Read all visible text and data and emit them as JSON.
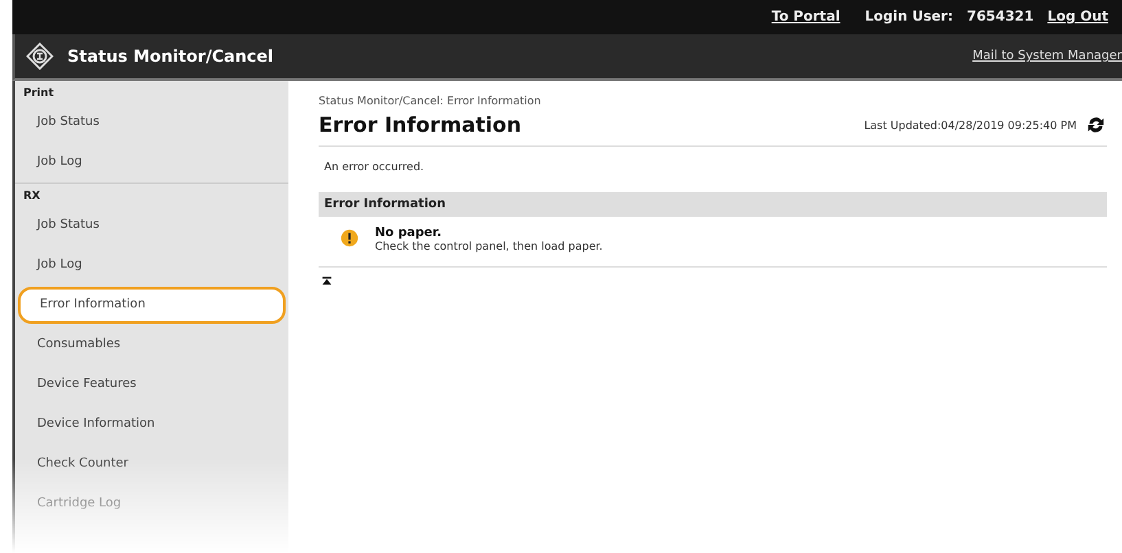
{
  "top_bar": {
    "links": [
      {
        "label": "To Portal",
        "kind": "link"
      },
      {
        "label": "Login User:",
        "kind": "text"
      },
      {
        "label": "7654321",
        "kind": "text"
      },
      {
        "label": "Log Out",
        "kind": "link"
      }
    ]
  },
  "header": {
    "title": "Status Monitor/Cancel",
    "mail_link": "Mail to System Manager"
  },
  "sidebar": {
    "sections": [
      {
        "heading": "Print",
        "items": [
          {
            "label": "Job Status",
            "selected": false
          },
          {
            "label": "Job Log",
            "selected": false
          }
        ]
      },
      {
        "heading": "RX",
        "items": [
          {
            "label": "Job Status",
            "selected": false
          },
          {
            "label": "Job Log",
            "selected": false
          },
          {
            "label": "Error Information",
            "selected": true
          },
          {
            "label": "Consumables",
            "selected": false
          },
          {
            "label": "Device Features",
            "selected": false
          },
          {
            "label": "Device Information",
            "selected": false
          },
          {
            "label": "Check Counter",
            "selected": false
          },
          {
            "label": "Cartridge Log",
            "selected": false
          }
        ]
      }
    ]
  },
  "main": {
    "breadcrumb": "Status Monitor/Cancel: Error Information",
    "title": "Error Information",
    "last_updated": "Last Updated:04/28/2019 09:25:40 PM",
    "message": "An error occurred.",
    "section_heading": "Error Information",
    "errors": [
      {
        "title": "No paper.",
        "detail": "Check the control panel, then load paper."
      }
    ]
  }
}
